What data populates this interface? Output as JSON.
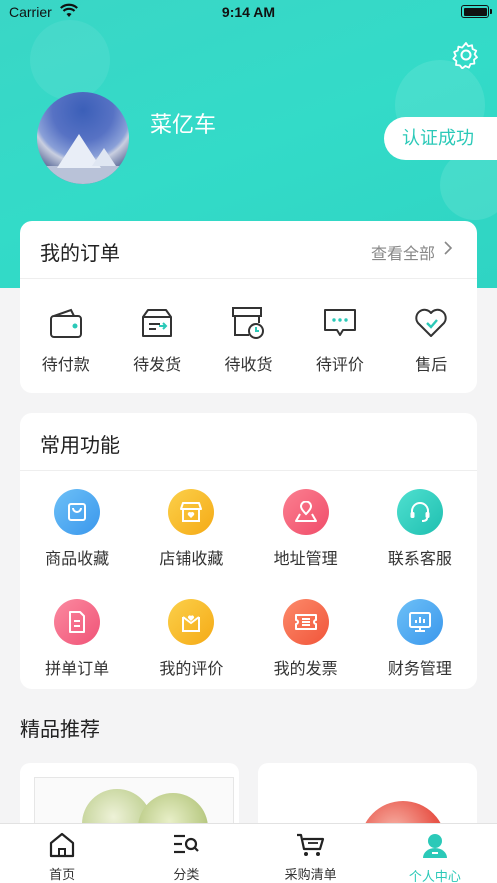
{
  "status_bar": {
    "carrier": "Carrier",
    "time": "9:14 AM"
  },
  "profile": {
    "username": "菜亿车",
    "verify_label": "认证成功"
  },
  "orders": {
    "title": "我的订单",
    "view_all": "查看全部",
    "items": [
      {
        "label": "待付款",
        "icon": "wallet-icon"
      },
      {
        "label": "待发货",
        "icon": "box-icon"
      },
      {
        "label": "待收货",
        "icon": "delivery-box-icon"
      },
      {
        "label": "待评价",
        "icon": "comment-icon"
      },
      {
        "label": "售后",
        "icon": "heart-icon"
      }
    ]
  },
  "functions": {
    "title": "常用功能",
    "items": [
      {
        "label": "商品收藏",
        "icon": "bag-icon",
        "color": "#4aa8f0"
      },
      {
        "label": "店铺收藏",
        "icon": "store-icon",
        "color": "#f7b820"
      },
      {
        "label": "地址管理",
        "icon": "map-icon",
        "color": "#f5647c"
      },
      {
        "label": "联系客服",
        "icon": "headset-icon",
        "color": "#2ecfc0"
      },
      {
        "label": "拼单订单",
        "icon": "document-icon",
        "color": "#f56b86"
      },
      {
        "label": "我的评价",
        "icon": "review-icon",
        "color": "#f7b820"
      },
      {
        "label": "我的发票",
        "icon": "invoice-icon",
        "color": "#f7694f"
      },
      {
        "label": "财务管理",
        "icon": "monitor-icon",
        "color": "#4aa8f0"
      }
    ]
  },
  "recommend": {
    "title": "精品推荐"
  },
  "tabbar": {
    "items": [
      {
        "label": "首页",
        "icon": "home-icon",
        "active": false
      },
      {
        "label": "分类",
        "icon": "category-search-icon",
        "active": false
      },
      {
        "label": "采购清单",
        "icon": "cart-icon",
        "active": false
      },
      {
        "label": "个人中心",
        "icon": "profile-icon",
        "active": true
      }
    ]
  },
  "colors": {
    "accent": "#2bc9b8",
    "hero": "#33dbc8"
  }
}
